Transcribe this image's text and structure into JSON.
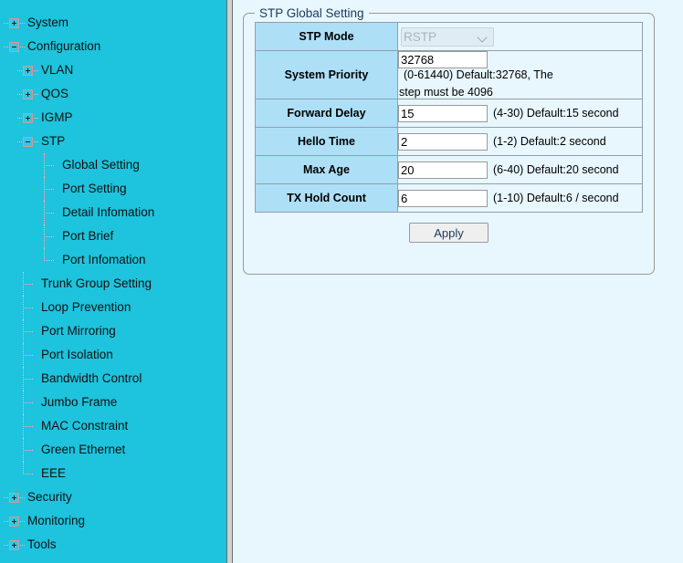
{
  "sidebar": {
    "nodes": [
      {
        "label": "System",
        "level": 0,
        "type": "expander",
        "state": "collapsed"
      },
      {
        "label": "Configuration",
        "level": 0,
        "type": "expander",
        "state": "expanded"
      },
      {
        "label": "VLAN",
        "level": 1,
        "type": "expander",
        "state": "collapsed"
      },
      {
        "label": "QOS",
        "level": 1,
        "type": "expander",
        "state": "collapsed"
      },
      {
        "label": "IGMP",
        "level": 1,
        "type": "expander",
        "state": "collapsed"
      },
      {
        "label": "STP",
        "level": 1,
        "type": "expander",
        "state": "expanded"
      },
      {
        "label": "Global Setting",
        "level": 2,
        "type": "leaf"
      },
      {
        "label": "Port Setting",
        "level": 2,
        "type": "leaf"
      },
      {
        "label": "Detail Infomation",
        "level": 2,
        "type": "leaf"
      },
      {
        "label": "Port Brief",
        "level": 2,
        "type": "leaf"
      },
      {
        "label": "Port Infomation",
        "level": 2,
        "type": "leaf",
        "last": true
      },
      {
        "label": "Trunk Group Setting",
        "level": 1,
        "type": "leaf"
      },
      {
        "label": "Loop Prevention",
        "level": 1,
        "type": "leaf"
      },
      {
        "label": "Port Mirroring",
        "level": 1,
        "type": "leaf"
      },
      {
        "label": "Port Isolation",
        "level": 1,
        "type": "leaf"
      },
      {
        "label": "Bandwidth Control",
        "level": 1,
        "type": "leaf"
      },
      {
        "label": "Jumbo Frame",
        "level": 1,
        "type": "leaf"
      },
      {
        "label": "MAC Constraint",
        "level": 1,
        "type": "leaf"
      },
      {
        "label": "Green Ethernet",
        "level": 1,
        "type": "leaf"
      },
      {
        "label": "EEE",
        "level": 1,
        "type": "leaf",
        "last": true
      },
      {
        "label": "Security",
        "level": 0,
        "type": "expander",
        "state": "collapsed"
      },
      {
        "label": "Monitoring",
        "level": 0,
        "type": "expander",
        "state": "collapsed"
      },
      {
        "label": "Tools",
        "level": 0,
        "type": "expander",
        "state": "collapsed"
      }
    ]
  },
  "panel": {
    "legend": "STP Global Setting",
    "rows": [
      {
        "label": "STP Mode",
        "control": "select",
        "value": "RSTP",
        "options": [
          "RSTP"
        ],
        "disabled": true,
        "hint": "",
        "hint2": ""
      },
      {
        "label": "System Priority",
        "control": "text",
        "value": "32768",
        "hint": "(0-61440) Default:32768, The",
        "hint2": "step must be 4096"
      },
      {
        "label": "Forward Delay",
        "control": "text",
        "value": "15",
        "hint": "(4-30) Default:15 second",
        "hint2": ""
      },
      {
        "label": "Hello Time",
        "control": "text",
        "value": "2",
        "hint": "(1-2) Default:2 second",
        "hint2": ""
      },
      {
        "label": "Max Age",
        "control": "text",
        "value": "20",
        "hint": "(6-40) Default:20 second",
        "hint2": ""
      },
      {
        "label": "TX Hold Count",
        "control": "text",
        "value": "6",
        "hint": "(1-10) Default:6 / second",
        "hint2": ""
      }
    ],
    "apply_label": "Apply"
  },
  "colors": {
    "sidebar_bg": "#1ec3dd",
    "content_bg": "#e8f6fd",
    "label_cell_bg": "#addff7",
    "panel_border": "#9a9a9a",
    "legend_text": "#1b3a5c"
  }
}
